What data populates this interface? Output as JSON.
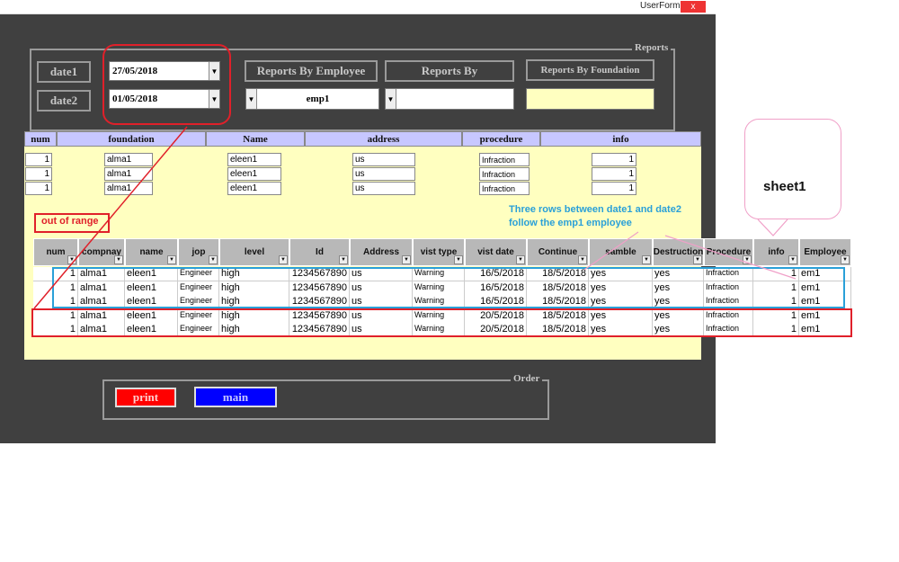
{
  "window": {
    "title": "UserForm2",
    "close": "x"
  },
  "reports": {
    "legend": "Reports",
    "date1_label": "date1",
    "date2_label": "date2",
    "date1_value": "27/05/2018",
    "date2_value": "01/05/2018",
    "by_employee_label": "Reports By Employee",
    "by_label": "Reports By",
    "by_foundation_label": "Reports By Foundation",
    "employee_value": "emp1",
    "by_value": "",
    "foundation_value": ""
  },
  "top_table": {
    "headers": [
      "num",
      "foundation",
      "Name",
      "address",
      "procedure",
      "info"
    ],
    "rows": [
      [
        "1",
        "alma1",
        "eleen1",
        "us",
        "Infraction",
        "1"
      ],
      [
        "1",
        "alma1",
        "eleen1",
        "us",
        "Infraction",
        "1"
      ],
      [
        "1",
        "alma1",
        "eleen1",
        "us",
        "Infraction",
        "1"
      ]
    ]
  },
  "sheet": {
    "headers": [
      "num",
      "compnay",
      "name",
      "jop",
      "level",
      "Id",
      "Address",
      "vist type",
      "vist date",
      "Continue",
      "samble",
      "Destruction",
      "Procedure",
      "info",
      "Employee"
    ],
    "rows": [
      [
        "1",
        "alma1",
        "eleen1",
        "Engineer",
        "high",
        "1234567890",
        "us",
        "Warning",
        "16/5/2018",
        "18/5/2018",
        "yes",
        "yes",
        "Infraction",
        "1",
        "em1"
      ],
      [
        "1",
        "alma1",
        "eleen1",
        "Engineer",
        "high",
        "1234567890",
        "us",
        "Warning",
        "16/5/2018",
        "18/5/2018",
        "yes",
        "yes",
        "Infraction",
        "1",
        "em1"
      ],
      [
        "1",
        "alma1",
        "eleen1",
        "Engineer",
        "high",
        "1234567890",
        "us",
        "Warning",
        "16/5/2018",
        "18/5/2018",
        "yes",
        "yes",
        "Infraction",
        "1",
        "em1"
      ],
      [
        "1",
        "alma1",
        "eleen1",
        "Engineer",
        "high",
        "1234567890",
        "us",
        "Warning",
        "20/5/2018",
        "18/5/2018",
        "yes",
        "yes",
        "Infraction",
        "1",
        "em1"
      ],
      [
        "1",
        "alma1",
        "eleen1",
        "Engineer",
        "high",
        "1234567890",
        "us",
        "Warning",
        "20/5/2018",
        "18/5/2018",
        "yes",
        "yes",
        "Infraction",
        "1",
        "em1"
      ]
    ]
  },
  "annotations": {
    "out_of_range": "out of range",
    "three_rows": "Three rows between date1 and date2 follow the emp1 employee",
    "sheet1": "sheet1"
  },
  "order": {
    "legend": "Order",
    "print": "print",
    "main": "main"
  },
  "colors": {
    "form_bg": "#404040",
    "panel": "#ffffc0",
    "header": "#c7c7ff",
    "red": "#e0202a",
    "blue": "#2aa0d8",
    "pink": "#f0a0c8"
  }
}
